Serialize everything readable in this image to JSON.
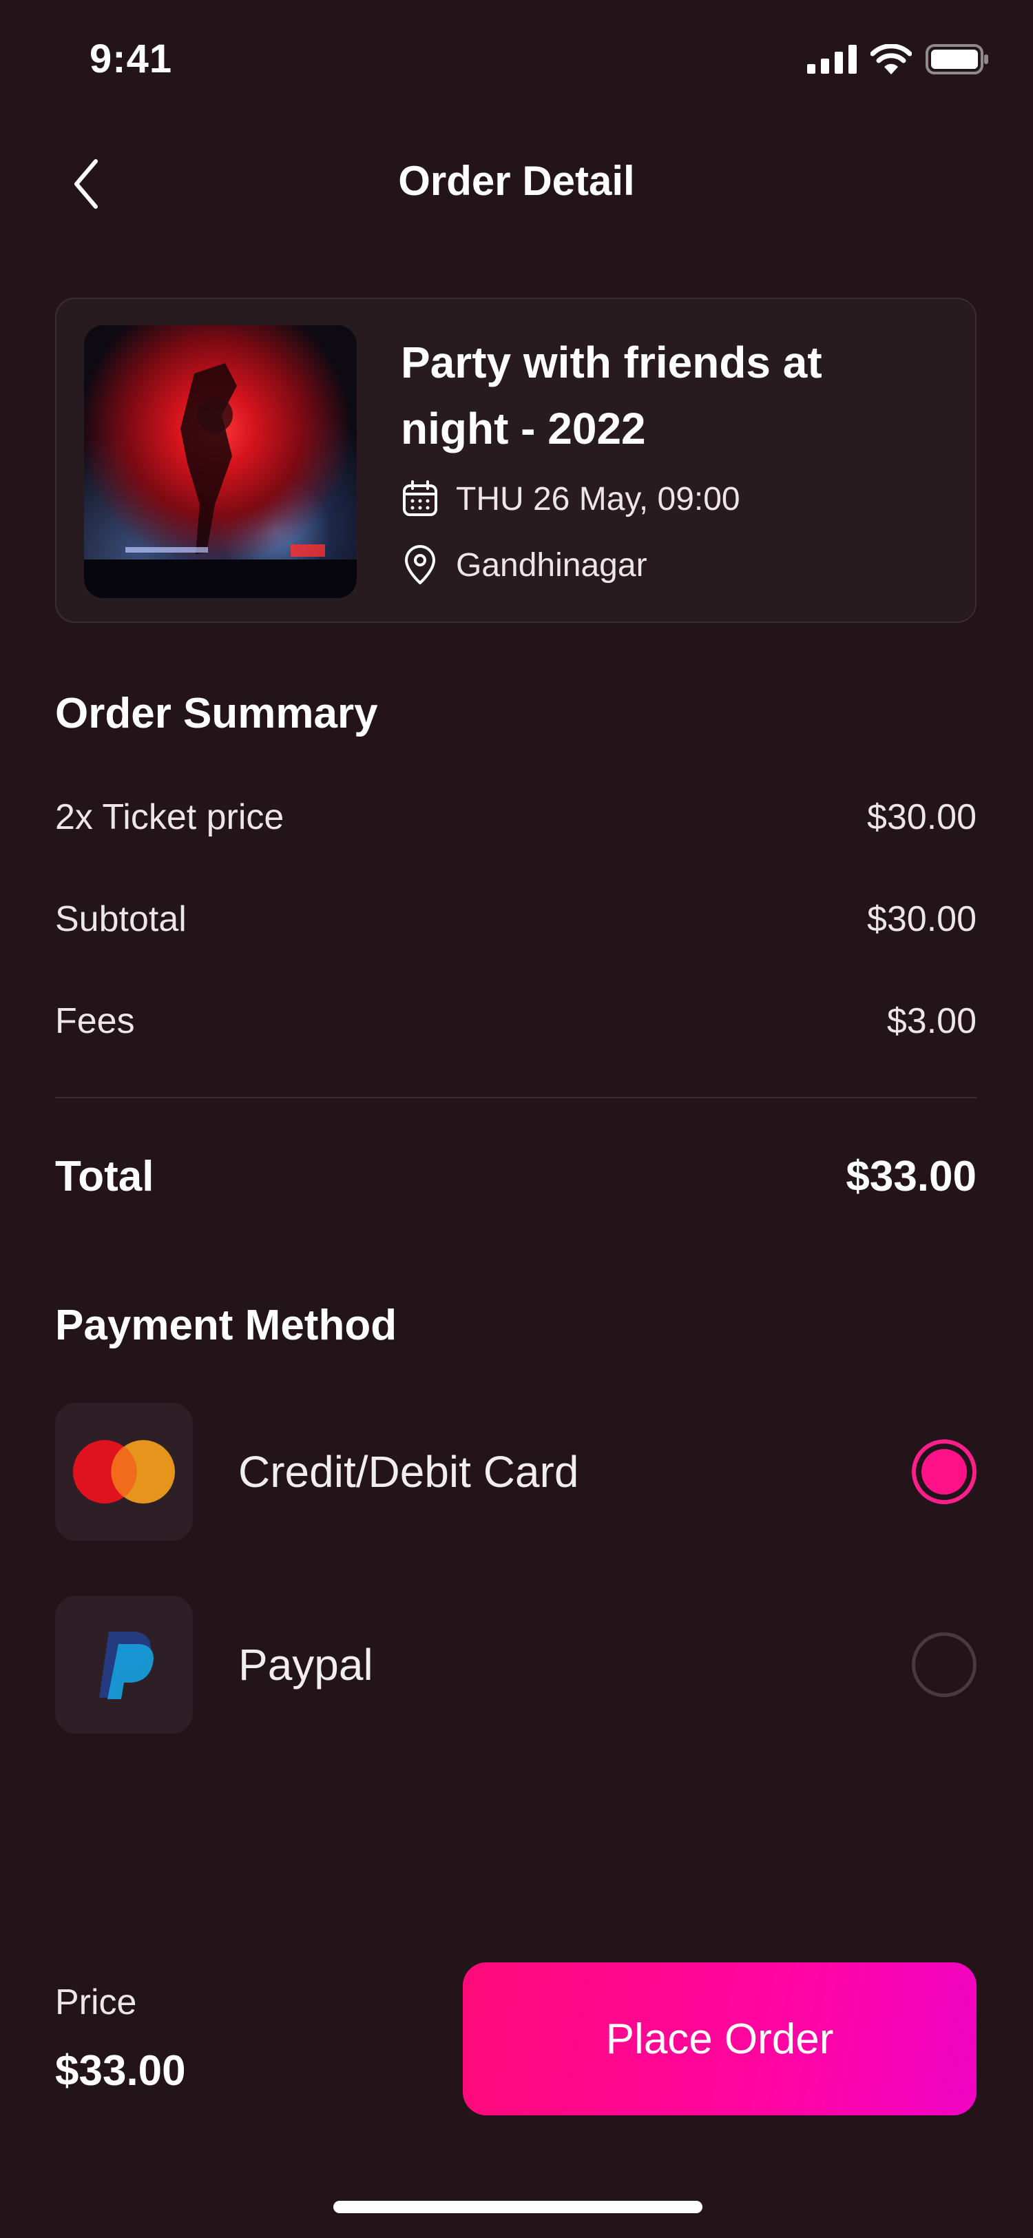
{
  "status_bar": {
    "time": "9:41"
  },
  "header": {
    "title": "Order Detail"
  },
  "event": {
    "title_line1": "Party with friends at",
    "title_line2": "night - 2022",
    "date": "THU 26 May, 09:00",
    "location": "Gandhinagar"
  },
  "order_summary": {
    "title": "Order Summary",
    "rows": [
      {
        "label": "2x Ticket price",
        "value": "$30.00"
      },
      {
        "label": "Subtotal",
        "value": "$30.00"
      },
      {
        "label": "Fees",
        "value": "$3.00"
      }
    ],
    "total_label": "Total",
    "total_value": "$33.00"
  },
  "payment": {
    "title": "Payment Method",
    "methods": [
      {
        "label": "Credit/Debit Card",
        "icon": "mastercard-icon",
        "selected": true
      },
      {
        "label": "Paypal",
        "icon": "paypal-icon",
        "selected": false
      }
    ]
  },
  "footer": {
    "price_label": "Price",
    "price_value": "$33.00",
    "button_label": "Place Order"
  },
  "colors": {
    "background": "#221419",
    "accent": "#ff0a8a",
    "card": "#281b20"
  }
}
